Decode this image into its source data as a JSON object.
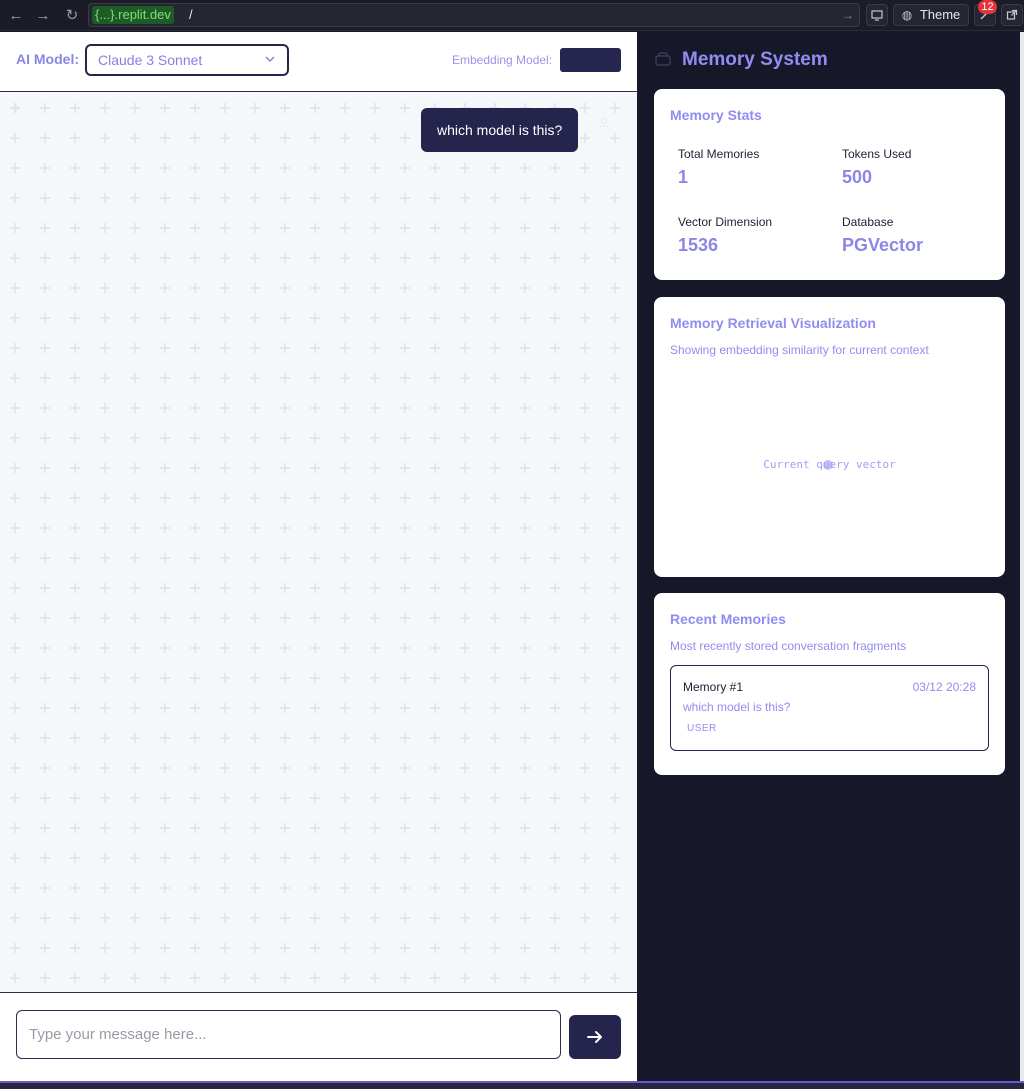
{
  "browser": {
    "url_domain": "{...}.replit.dev",
    "url_path": "/",
    "theme_label": "Theme",
    "notification_count": "12",
    "icons": [
      "back-icon",
      "forward-icon",
      "reload-icon",
      "go-icon",
      "devices-icon",
      "palette-icon",
      "tools-icon",
      "new-tab-icon"
    ]
  },
  "chat": {
    "model_label": "AI Model:",
    "model_selected": "Claude 3 Sonnet",
    "embedding_label": "Embedding Model:",
    "embedding_selected": "",
    "messages": [
      {
        "role": "user",
        "text": "which model is this?"
      }
    ],
    "input_placeholder": "Type your message here...",
    "input_value": ""
  },
  "memory": {
    "title": "Memory System",
    "stats": {
      "title": "Memory Stats",
      "items": [
        {
          "label": "Total Memories",
          "value": "1"
        },
        {
          "label": "Tokens Used",
          "value": "500"
        },
        {
          "label": "Vector Dimension",
          "value": "1536"
        },
        {
          "label": "Database",
          "value": "PGVector"
        }
      ]
    },
    "viz": {
      "title": "Memory Retrieval Visualization",
      "subtitle": "Showing embedding similarity for current context",
      "center_label": "Current query vector"
    },
    "recent": {
      "title": "Recent Memories",
      "subtitle": "Most recently stored conversation fragments",
      "items": [
        {
          "name": "Memory #1",
          "date": "03/12 20:28",
          "text": "which model is this?",
          "tag": "USER"
        }
      ]
    }
  },
  "colors": {
    "accent": "#928cf0",
    "navy": "#24244c",
    "sidebar_bg": "#17172a"
  }
}
